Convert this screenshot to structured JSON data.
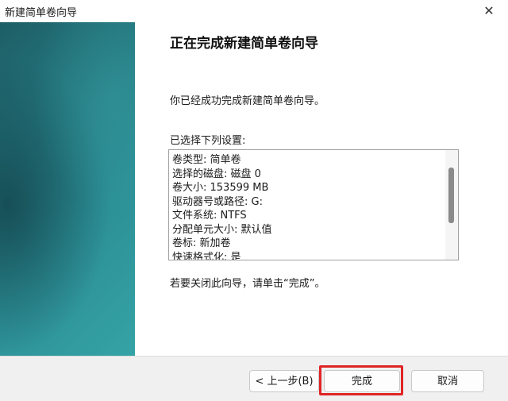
{
  "window": {
    "title": "新建简单卷向导",
    "close_glyph": "✕"
  },
  "main": {
    "heading": "正在完成新建简单卷向导",
    "success_text": "你已经成功完成新建简单卷向导。",
    "settings_label": "已选择下列设置:",
    "settings": [
      "卷类型: 简单卷",
      "选择的磁盘: 磁盘 0",
      "卷大小: 153599 MB",
      "驱动器号或路径: G:",
      "文件系统: NTFS",
      "分配单元大小: 默认值",
      "卷标: 新加卷",
      "快速格式化: 是"
    ],
    "close_hint": "若要关闭此向导，请单击“完成”。"
  },
  "buttons": {
    "back": "< 上一步(B)",
    "finish": "完成",
    "cancel": "取消"
  },
  "colors": {
    "banner_accent": "#2c8f96",
    "highlight": "#e02424"
  },
  "icons": {
    "close": "close-icon"
  }
}
